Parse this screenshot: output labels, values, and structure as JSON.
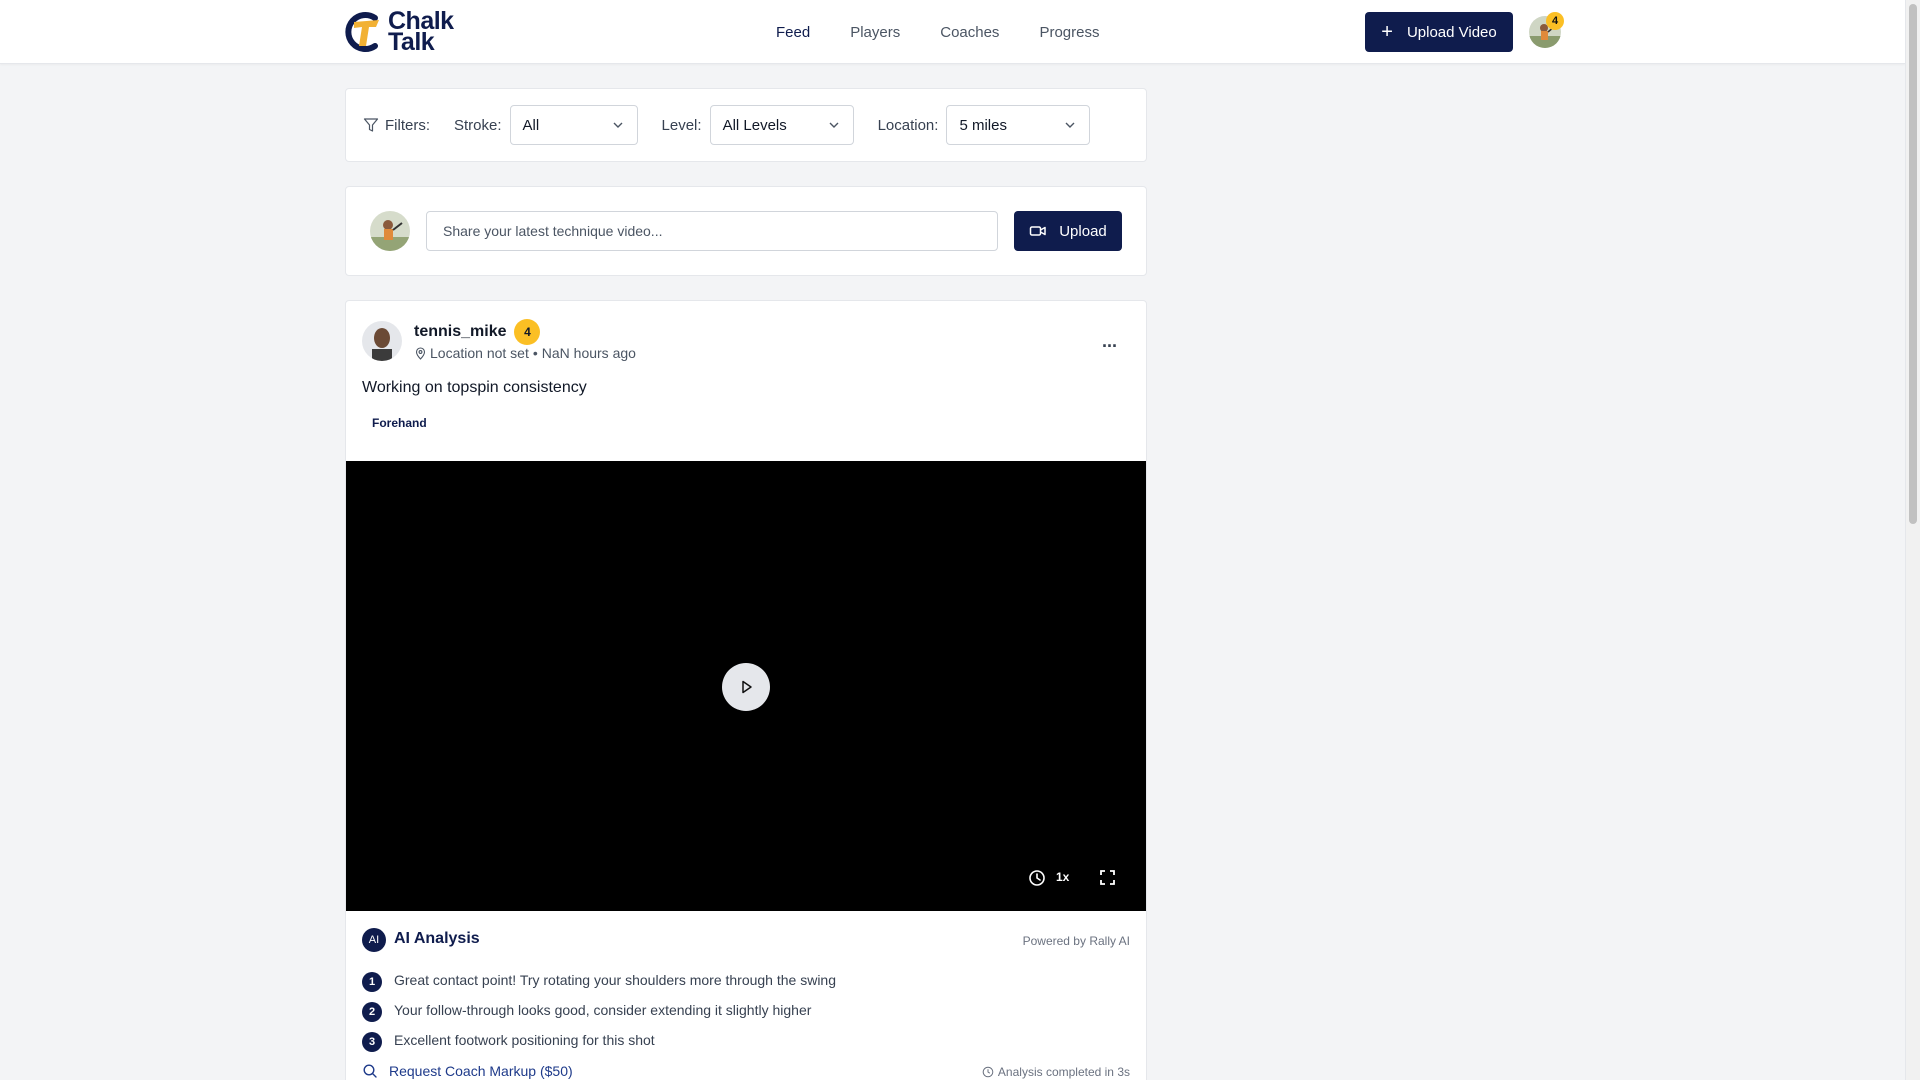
{
  "header": {
    "logo_line1": "Chalk",
    "logo_line2": "Talk",
    "nav": [
      {
        "label": "Feed"
      },
      {
        "label": "Players"
      },
      {
        "label": "Coaches"
      },
      {
        "label": "Progress"
      }
    ],
    "upload_label": "Upload Video",
    "notification_count": "4"
  },
  "filters": {
    "label": "Filters:",
    "stroke_label": "Stroke:",
    "stroke_value": "All",
    "level_label": "Level:",
    "level_value": "All Levels",
    "location_label": "Location:",
    "location_value": "5 miles"
  },
  "composer": {
    "placeholder": "Share your latest technique video...",
    "upload_label": "Upload"
  },
  "post": {
    "username": "tennis_mike",
    "level": "4",
    "location": "Location not set",
    "separator": "•",
    "time": "NaN hours ago",
    "more": "...",
    "caption": "Working on topspin consistency",
    "stroke_tag": "Forehand",
    "video": {
      "speed": "1x"
    },
    "ai": {
      "icon_text": "AI",
      "title": "AI Analysis",
      "powered_by": "Powered by Rally AI",
      "items": [
        {
          "num": "1",
          "text": "Great contact point! Try rotating your shoulders more through the swing"
        },
        {
          "num": "2",
          "text": "Your follow-through looks good, consider extending it slightly higher"
        },
        {
          "num": "3",
          "text": "Excellent footwork positioning for this shot"
        }
      ],
      "request_label": "Request Coach Markup ($50)",
      "completed_label": "Analysis completed in 3s"
    }
  },
  "colors": {
    "brand_navy": "#0f1c4d",
    "badge_yellow": "#fbbf24",
    "logo_gold": "#f2b134"
  }
}
